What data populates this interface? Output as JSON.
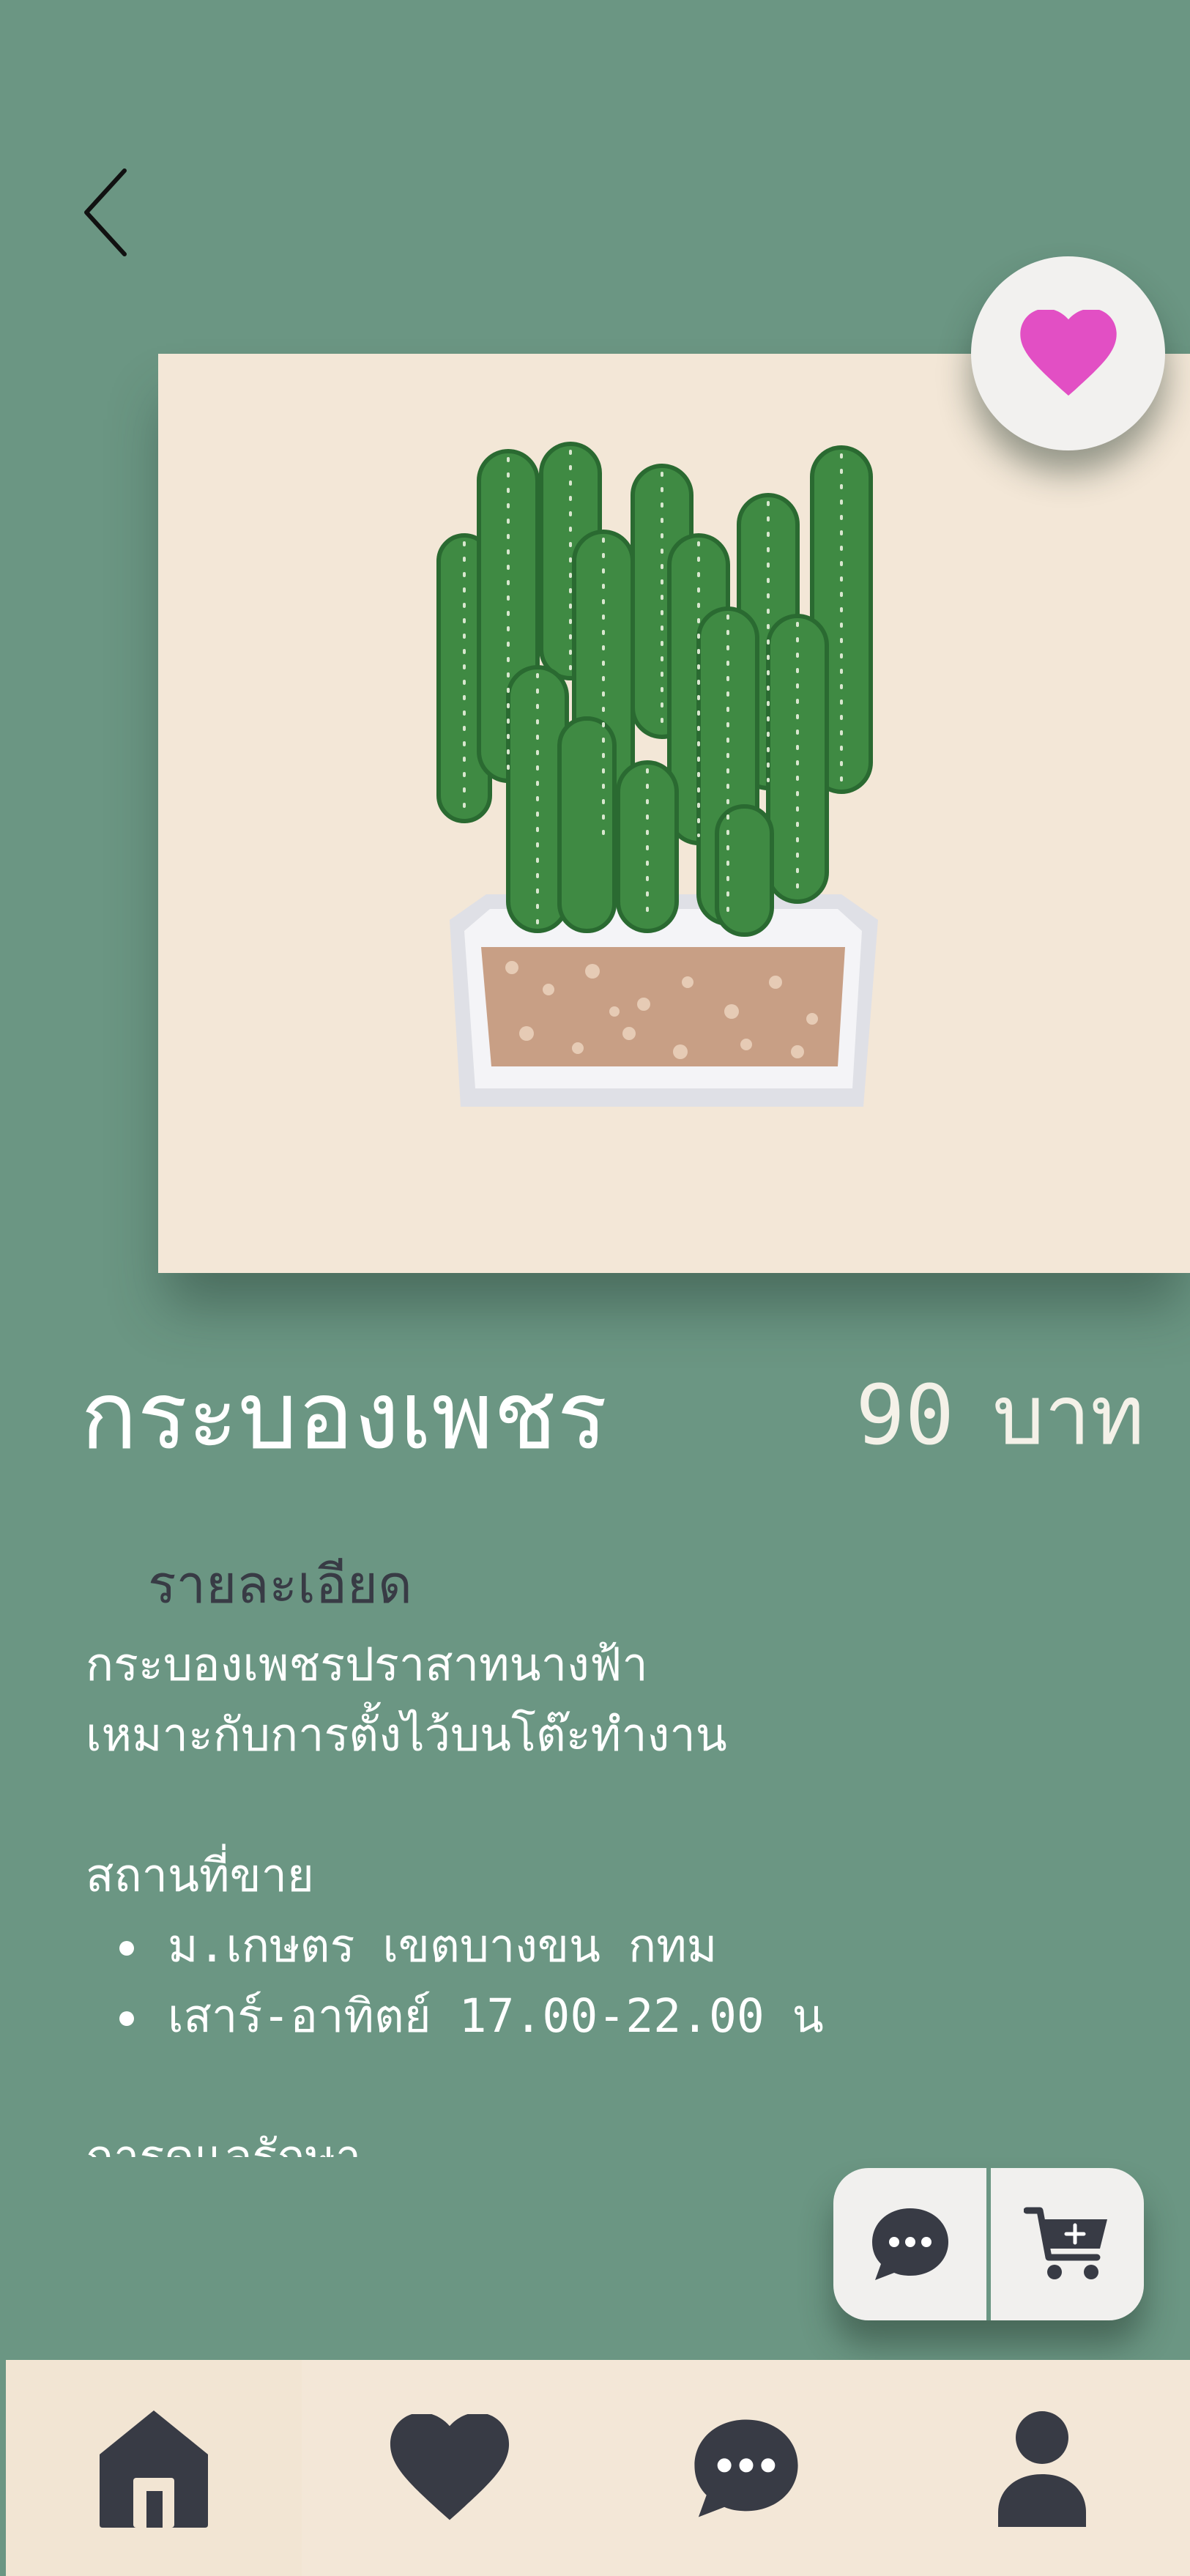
{
  "header": {
    "back_icon": "chevron-left-icon"
  },
  "product": {
    "name": "กระบองเพชร",
    "price_value": "90",
    "price_unit": "บาท",
    "photo_icon": "cactus-plant-image",
    "favorite_icon": "heart-icon",
    "favorite_color": "#e24fc4"
  },
  "details": {
    "label": "รายละเอียด",
    "lines": [
      "กระบองเพชรปราสาทนางฟ้า",
      "เหมาะกับการตั้งไว้บนโต๊ะทำงาน"
    ],
    "sale_place_heading": "สถานที่ขาย",
    "bullets": [
      "ม.เกษตร เขตบางขน กทม",
      "เสาร์-อาทิตย์ 17.00-22.00 น"
    ],
    "care_heading": "การดูแลรักษา"
  },
  "actions": {
    "chat_icon": "chat-bubble-icon",
    "add_to_cart_icon": "cart-plus-icon"
  },
  "bottom_nav": [
    {
      "icon": "home-icon"
    },
    {
      "icon": "heart-icon"
    },
    {
      "icon": "chat-bubble-icon"
    },
    {
      "icon": "user-icon"
    }
  ],
  "colors": {
    "background": "#6b9683",
    "cream": "#f3e7d7",
    "dark": "#383b45",
    "accent": "#e24fc4"
  }
}
